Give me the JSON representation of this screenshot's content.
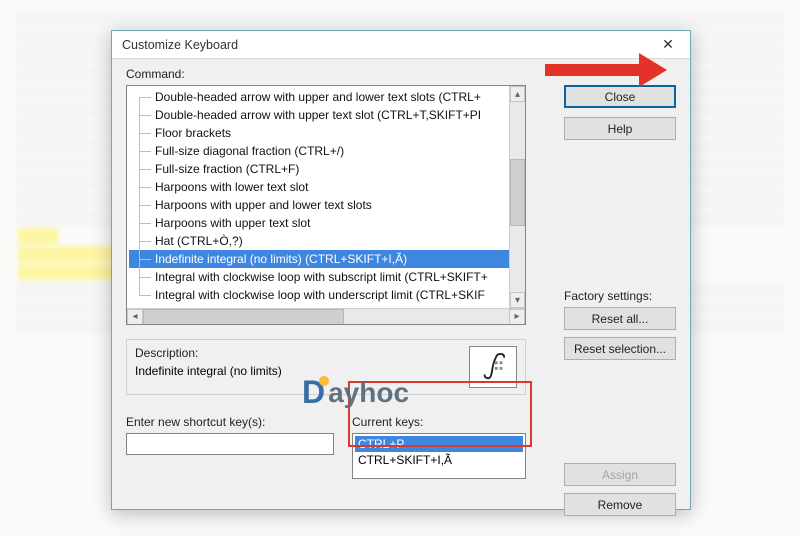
{
  "dialog": {
    "title": "Customize Keyboard",
    "labels": {
      "command": "Command:",
      "description": "Description:",
      "enter": "Enter new shortcut key(s):",
      "current": "Current keys:",
      "factory": "Factory settings:"
    },
    "buttons": {
      "close": "Close",
      "help": "Help",
      "reset_all": "Reset all...",
      "reset_selection": "Reset selection...",
      "assign": "Assign",
      "remove": "Remove"
    },
    "commands": [
      "Double-headed arrow with upper and lower text slots (CTRL+",
      "Double-headed arrow with upper text slot (CTRL+T,SKIFT+PI",
      "Floor brackets",
      "Full-size diagonal fraction (CTRL+/)",
      "Full-size fraction (CTRL+F)",
      "Harpoons with lower text slot",
      "Harpoons with upper and lower text slots",
      "Harpoons with upper text slot",
      "Hat (CTRL+Ò,?)",
      "Indefinite integral (no limits) (CTRL+SKIFT+I,Ã)",
      "Integral with clockwise loop with subscript limit (CTRL+SKIFT+",
      "Integral with clockwise loop with underscript limit (CTRL+SKIF"
    ],
    "selected_command_index": 9,
    "description_text": "Indefinite integral (no limits)",
    "enter_value": "",
    "current_keys": [
      "CTRL+P",
      "CTRL+SKIFT+I,Ã"
    ],
    "current_selected_index": 0
  },
  "watermark": {
    "brand_first": "D",
    "brand_rest": "ayhoc"
  }
}
